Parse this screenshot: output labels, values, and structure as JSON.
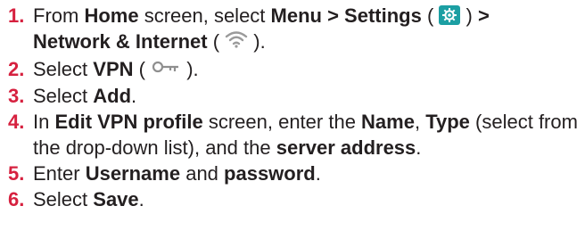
{
  "steps": [
    {
      "num": "1.",
      "t1": "From ",
      "b1": "Home",
      "t2": " screen, select ",
      "b2": "Menu > Settings",
      "t3": " ( ",
      "t4": " ) ",
      "b3": ">",
      "b4": "Network & Internet",
      "t5": " ( ",
      "t6": " ).",
      "icon_settings": "settings-gear-icon",
      "icon_wifi": "wifi-icon",
      "icon_color": "#1c9fa3"
    },
    {
      "num": "2.",
      "t1": "Select ",
      "b1": "VPN",
      "t2": " ( ",
      "t3": " ).",
      "icon_key": "vpn-key-icon"
    },
    {
      "num": "3.",
      "t1": "Select ",
      "b1": "Add",
      "t2": "."
    },
    {
      "num": "4.",
      "t1": "In ",
      "b1": "Edit VPN profile",
      "t2": " screen, enter the ",
      "b2": "Name",
      "t3": ", ",
      "b3": "Type",
      "t4": " (select from the drop-down list), and the ",
      "b4": "server address",
      "t5": "."
    },
    {
      "num": "5.",
      "t1": "Enter ",
      "b1": "Username",
      "t2": " and ",
      "b2": "password",
      "t3": "."
    },
    {
      "num": "6.",
      "t1": "Select ",
      "b1": "Save",
      "t2": "."
    }
  ],
  "colors": {
    "number": "#d6213f",
    "text": "#231f20"
  }
}
